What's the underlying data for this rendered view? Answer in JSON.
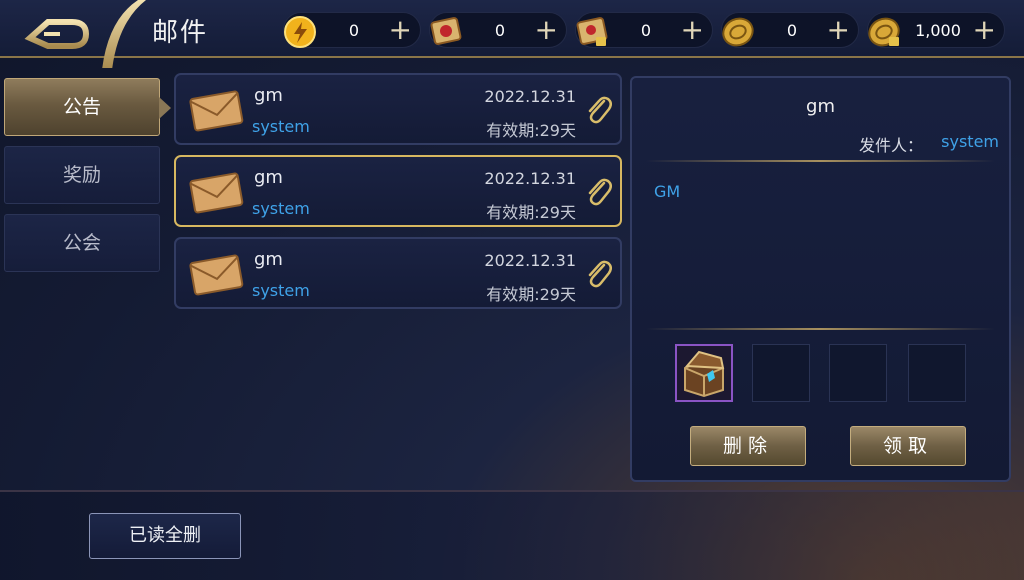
{
  "header": {
    "title": "邮件",
    "back_icon": "back-arrow-icon"
  },
  "resources": [
    {
      "icon": "gold-orb-icon",
      "value": "0",
      "plus": "+"
    },
    {
      "icon": "red-scroll-icon",
      "value": "0",
      "plus": "+"
    },
    {
      "icon": "locked-scroll-icon",
      "value": "0",
      "plus": "+"
    },
    {
      "icon": "gold-coin-icon",
      "value": "0",
      "plus": "+"
    },
    {
      "icon": "locked-coin-icon",
      "value": "1,000",
      "plus": "+"
    }
  ],
  "tabs": [
    {
      "label": "公告",
      "active": true
    },
    {
      "label": "奖励",
      "active": false
    },
    {
      "label": "公会",
      "active": false
    }
  ],
  "mails": [
    {
      "sender": "gm",
      "from": "system",
      "date": "2022.12.31",
      "expire": "有效期:29天",
      "selected": false
    },
    {
      "sender": "gm",
      "from": "system",
      "date": "2022.12.31",
      "expire": "有效期:29天",
      "selected": true
    },
    {
      "sender": "gm",
      "from": "system",
      "date": "2022.12.31",
      "expire": "有效期:29天",
      "selected": false
    }
  ],
  "detail": {
    "title": "gm",
    "sender_label": "发件人：",
    "sender_value": "system",
    "body": "GM",
    "attachments": [
      "treasure-chest-icon",
      "",
      "",
      ""
    ],
    "delete_label": "删除",
    "claim_label": "领取"
  },
  "footer": {
    "delete_read_label": "已读全删"
  },
  "colors": {
    "accent_gold": "#d7b860",
    "link_blue": "#3fa2e8",
    "panel": "#18203f"
  }
}
